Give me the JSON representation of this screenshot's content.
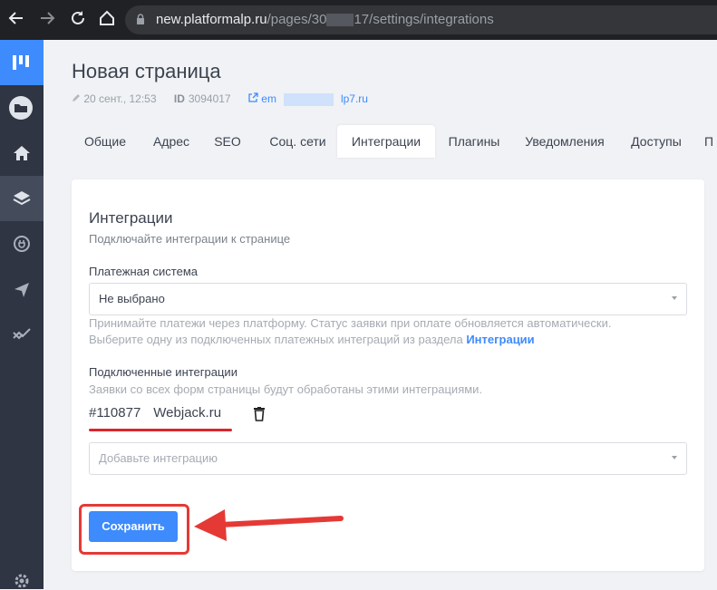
{
  "browser": {
    "url_host": "new.platformalp.ru",
    "url_path_a": "/pages/30",
    "url_path_b": "17/settings/integrations"
  },
  "page": {
    "title": "Новая страница",
    "date": "20 сент., 12:53",
    "id_label": "ID",
    "id_value": "3094017",
    "email_a": "em",
    "email_b": "lp7.ru"
  },
  "tabs": [
    "Общие",
    "Адрес",
    "SEO",
    "Соц. сети",
    "Интеграции",
    "Плагины",
    "Уведомления",
    "Доступы",
    "П"
  ],
  "active_tab": "Интеграции",
  "integrations": {
    "heading": "Интеграции",
    "subtitle": "Подключайте интеграции к странице",
    "payment_label": "Платежная система",
    "payment_value": "Не выбрано",
    "payment_hint_1": "Принимайте платежи через платформу. Статус заявки при оплате обновляется автоматически.",
    "payment_hint_2": "Выберите одну из подключенных платежных интеграций из раздела",
    "payment_hint_link": "Интеграции",
    "connected_label": "Подключенные интеграции",
    "connected_hint": "Заявки со всех форм страницы будут обработаны этими интеграциями.",
    "item_id": "#110877",
    "item_name": "Webjack.ru",
    "add_placeholder": "Добавьте интеграцию",
    "save_label": "Сохранить"
  },
  "colors": {
    "accent": "#3d8bfd",
    "sidebar": "#2f3542",
    "highlight": "#e53935"
  }
}
